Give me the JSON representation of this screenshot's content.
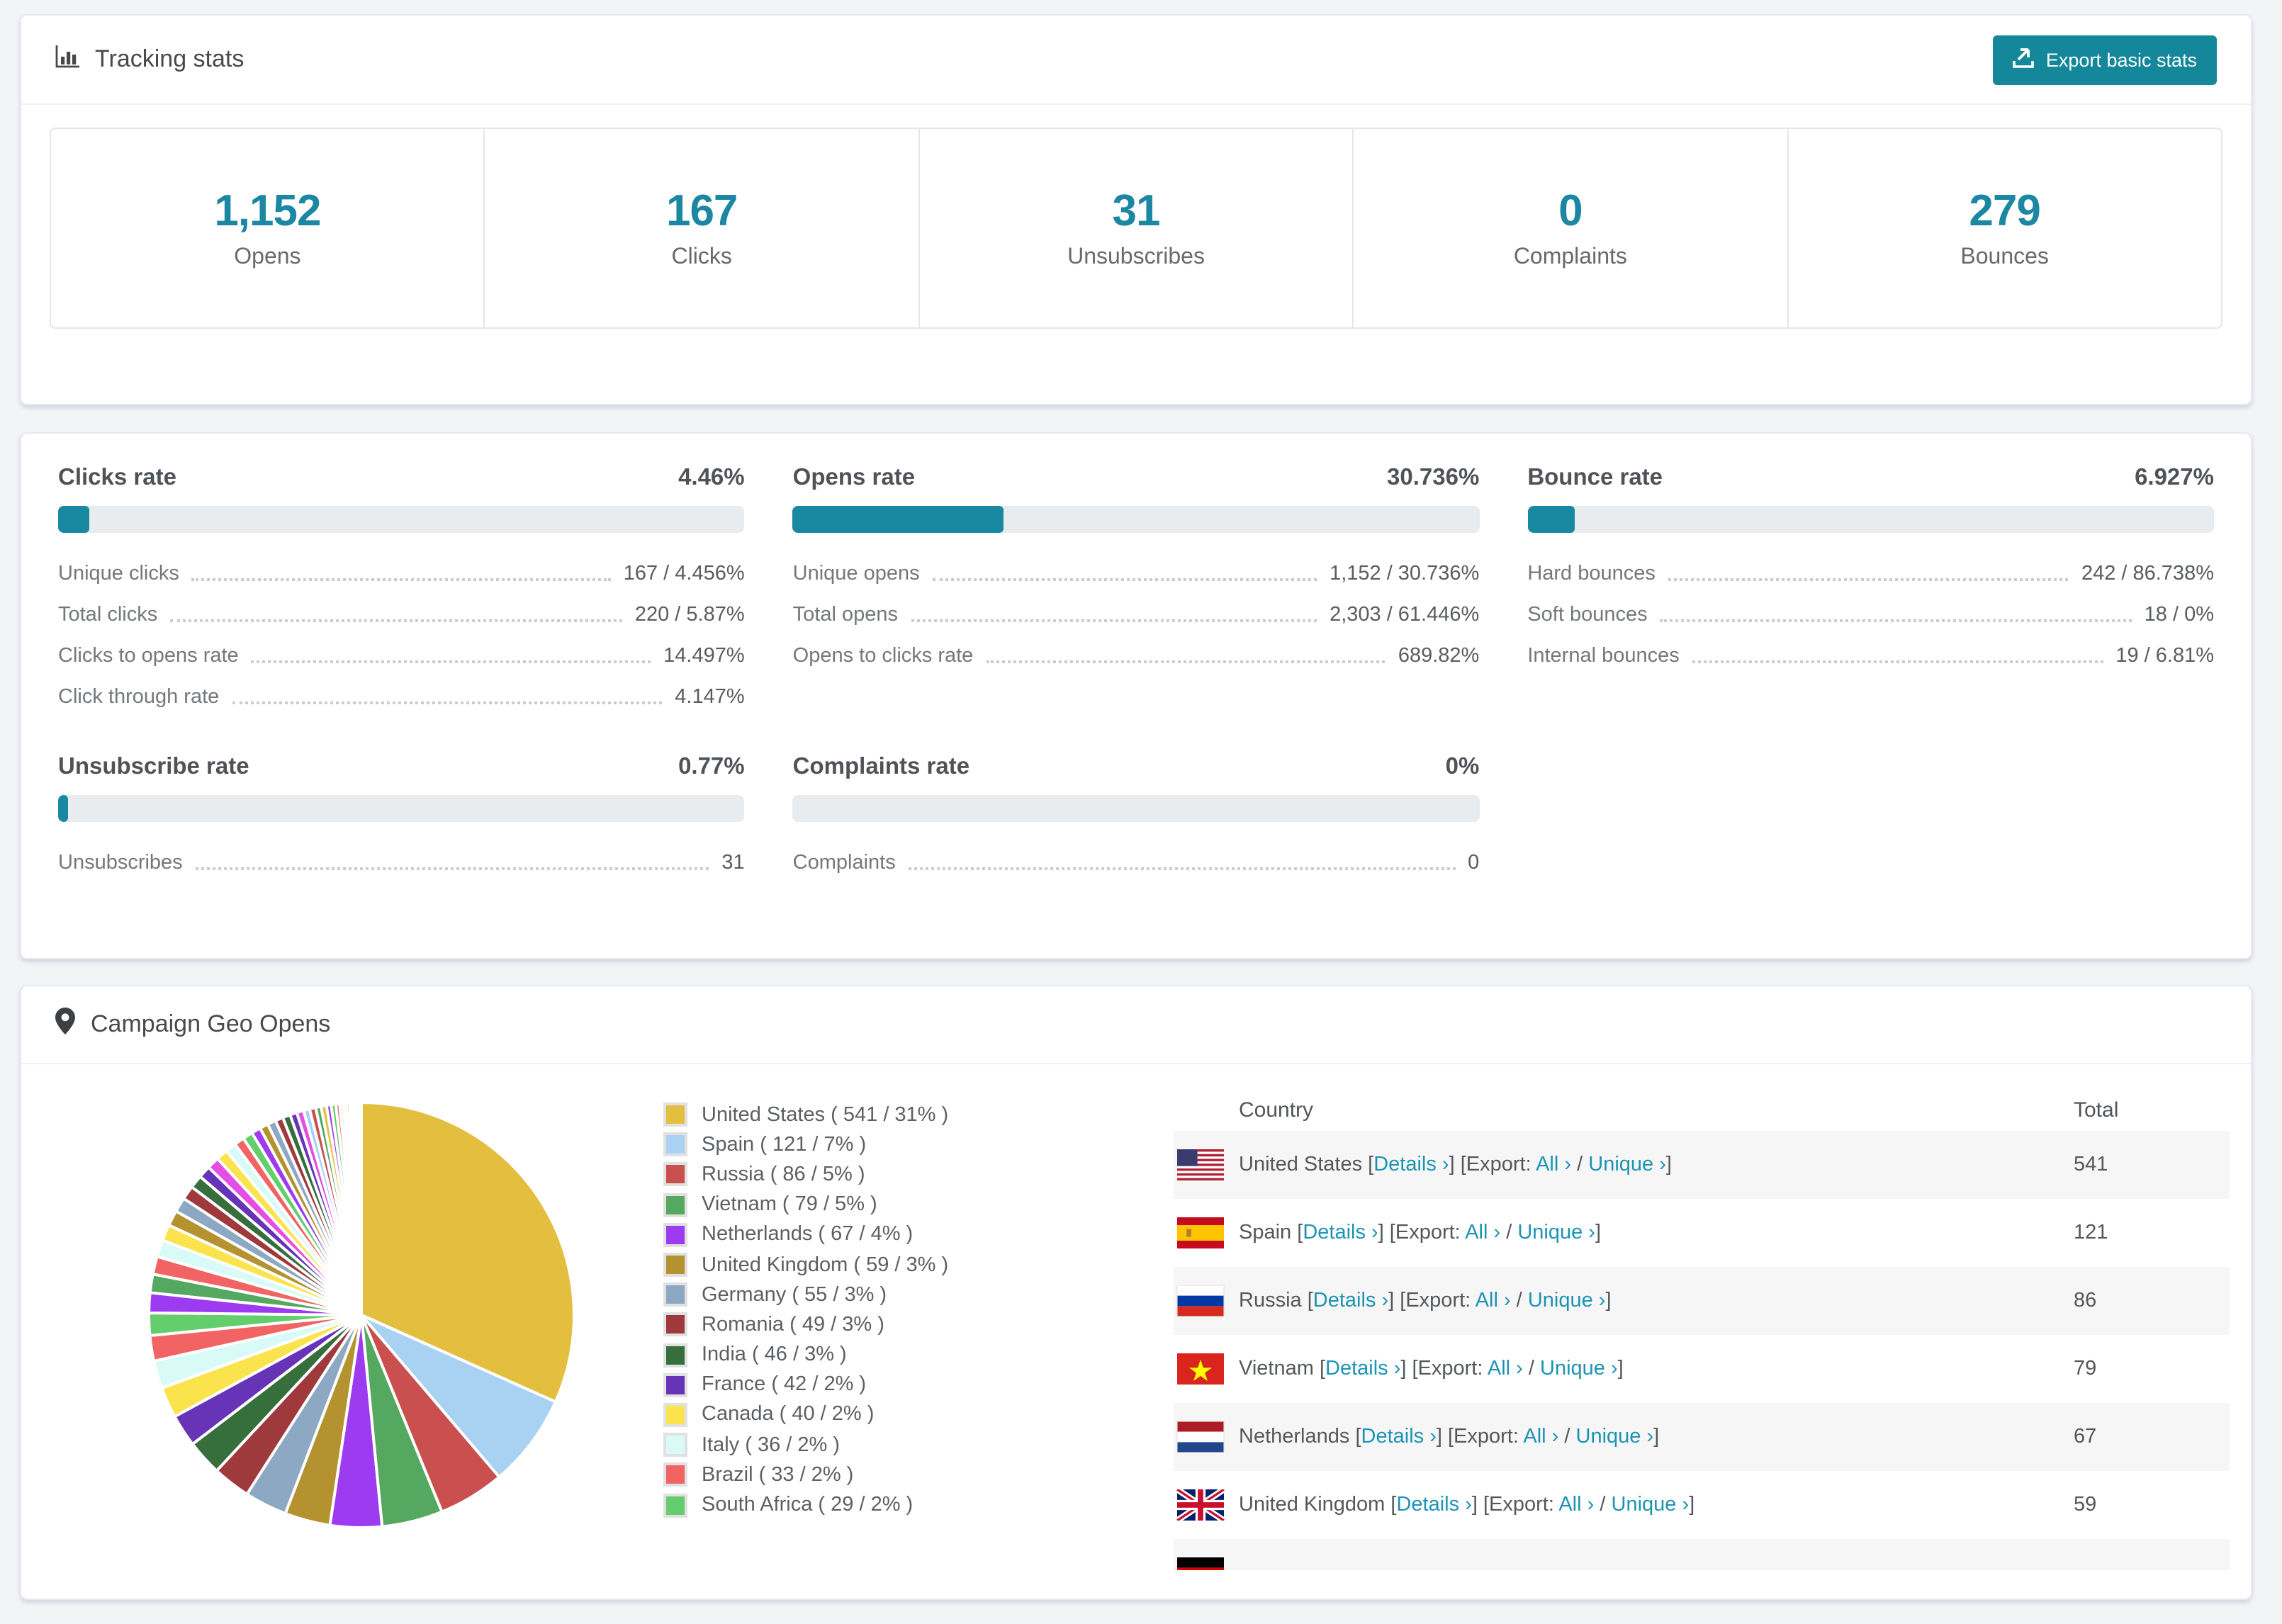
{
  "accent": "#1b87a3",
  "tracking": {
    "title": "Tracking stats",
    "export_label": "Export basic stats",
    "stats": [
      {
        "value": "1,152",
        "label": "Opens"
      },
      {
        "value": "167",
        "label": "Clicks"
      },
      {
        "value": "31",
        "label": "Unsubscribes"
      },
      {
        "value": "0",
        "label": "Complaints"
      },
      {
        "value": "279",
        "label": "Bounces"
      }
    ]
  },
  "rates": {
    "row1": [
      {
        "title": "Clicks rate",
        "value": "4.46%",
        "bar_pct": 4.46,
        "items": [
          {
            "label": "Unique clicks",
            "value": "167 / 4.456%"
          },
          {
            "label": "Total clicks",
            "value": "220 / 5.87%"
          },
          {
            "label": "Clicks to opens rate",
            "value": "14.497%"
          },
          {
            "label": "Click through rate",
            "value": "4.147%"
          }
        ]
      },
      {
        "title": "Opens rate",
        "value": "30.736%",
        "bar_pct": 30.736,
        "items": [
          {
            "label": "Unique opens",
            "value": "1,152 / 30.736%"
          },
          {
            "label": "Total opens",
            "value": "2,303 / 61.446%"
          },
          {
            "label": "Opens to clicks rate",
            "value": "689.82%"
          }
        ]
      },
      {
        "title": "Bounce rate",
        "value": "6.927%",
        "bar_pct": 6.927,
        "items": [
          {
            "label": "Hard bounces",
            "value": "242 / 86.738%"
          },
          {
            "label": "Soft bounces",
            "value": "18 / 0%"
          },
          {
            "label": "Internal bounces",
            "value": "19 / 6.81%"
          }
        ]
      }
    ],
    "row2": [
      {
        "title": "Unsubscribe rate",
        "value": "0.77%",
        "bar_pct": 0.77,
        "items": [
          {
            "label": "Unsubscribes",
            "value": "31"
          }
        ]
      },
      {
        "title": "Complaints rate",
        "value": "0%",
        "bar_pct": 0,
        "items": [
          {
            "label": "Complaints",
            "value": "0"
          }
        ]
      }
    ]
  },
  "geo": {
    "title": "Campaign Geo Opens",
    "table": {
      "col_country": "Country",
      "col_total": "Total",
      "details_label": "Details ›",
      "export_label": "Export:",
      "all_label": "All ›",
      "unique_label": "Unique ›",
      "rows": [
        {
          "flag": "us",
          "name": "United States",
          "total": "541"
        },
        {
          "flag": "es",
          "name": "Spain",
          "total": "121"
        },
        {
          "flag": "ru",
          "name": "Russia",
          "total": "86"
        },
        {
          "flag": "vn",
          "name": "Vietnam",
          "total": "79"
        },
        {
          "flag": "nl",
          "name": "Netherlands",
          "total": "67"
        },
        {
          "flag": "gb",
          "name": "United Kingdom",
          "total": "59"
        },
        {
          "flag": "de",
          "partial": true
        }
      ]
    }
  },
  "chart_data": {
    "type": "pie",
    "title": "Campaign Geo Opens",
    "legend_position": "right",
    "segments": [
      {
        "label": "United States ( 541 / 31% )",
        "name": "United States",
        "value": 541,
        "pct": 31,
        "color": "#E3BE3F"
      },
      {
        "label": "Spain ( 121 / 7% )",
        "name": "Spain",
        "value": 121,
        "pct": 7,
        "color": "#A8D1F2"
      },
      {
        "label": "Russia ( 86 / 5% )",
        "name": "Russia",
        "value": 86,
        "pct": 5,
        "color": "#C9504F"
      },
      {
        "label": "Vietnam ( 79 / 5% )",
        "name": "Vietnam",
        "value": 79,
        "pct": 5,
        "color": "#55A860"
      },
      {
        "label": "Netherlands ( 67 / 4% )",
        "name": "Netherlands",
        "value": 67,
        "pct": 4,
        "color": "#9D3BF0"
      },
      {
        "label": "United Kingdom ( 59 / 3% )",
        "name": "United Kingdom",
        "value": 59,
        "pct": 3,
        "color": "#B3922F"
      },
      {
        "label": "Germany ( 55 / 3% )",
        "name": "Germany",
        "value": 55,
        "pct": 3,
        "color": "#8CA8C2"
      },
      {
        "label": "Romania ( 49 / 3% )",
        "name": "Romania",
        "value": 49,
        "pct": 3,
        "color": "#9E3A3C"
      },
      {
        "label": "India ( 46 / 3% )",
        "name": "India",
        "value": 46,
        "pct": 3,
        "color": "#366F3C"
      },
      {
        "label": "France ( 42 / 2% )",
        "name": "France",
        "value": 42,
        "pct": 2,
        "color": "#6734B8"
      },
      {
        "label": "Canada ( 40 / 2% )",
        "name": "Canada",
        "value": 40,
        "pct": 2,
        "color": "#FBE34D"
      },
      {
        "label": "Italy ( 36 / 2% )",
        "name": "Italy",
        "value": 36,
        "pct": 2,
        "color": "#D9FBF7"
      },
      {
        "label": "Brazil ( 33 / 2% )",
        "name": "Brazil",
        "value": 33,
        "pct": 2,
        "color": "#F26464"
      },
      {
        "label": "South Africa ( 29 / 2% )",
        "name": "South Africa",
        "value": 29,
        "pct": 2,
        "color": "#63CE6B"
      }
    ],
    "other_segments_values": [
      26,
      24,
      23,
      22,
      21,
      20,
      19,
      18,
      17,
      16,
      16,
      15,
      14,
      13,
      13,
      12,
      11,
      11,
      10,
      10,
      9,
      9,
      8,
      8,
      7,
      7,
      6,
      6,
      5,
      5,
      4,
      4,
      3,
      3,
      2,
      2,
      2,
      1,
      1,
      1
    ],
    "other_segments_colors": [
      "#9D3BF0",
      "#55A860",
      "#F26464",
      "#D9FBF7",
      "#FBE34D",
      "#B3922F",
      "#8CA8C2",
      "#9E3A3C",
      "#366F3C",
      "#6734B8",
      "#E34FE3",
      "#FBE34D",
      "#D9FBF7",
      "#F26464",
      "#63CE6B",
      "#9D3BF0",
      "#B3922F",
      "#8CA8C2",
      "#9E3A3C",
      "#366F3C",
      "#6734B8",
      "#E34FE3",
      "#A8D1F2",
      "#C9504F",
      "#55A860",
      "#E3BE3F",
      "#9D3BF0",
      "#63CE6B",
      "#F26464",
      "#D9FBF7",
      "#FBE34D",
      "#B3922F",
      "#8CA8C2",
      "#E34FE3",
      "#A8D1F2",
      "#C9504F",
      "#55A860",
      "#6734B8",
      "#E3BE3F",
      "#9D3BF0"
    ]
  }
}
